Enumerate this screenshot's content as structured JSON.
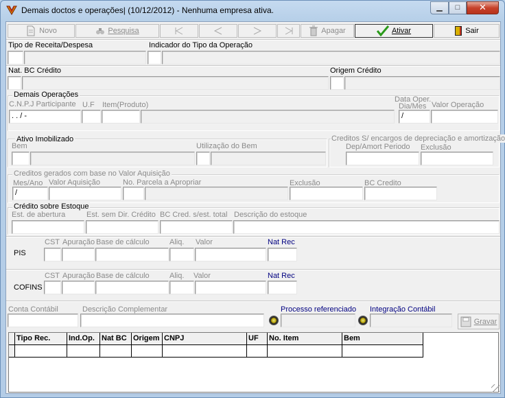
{
  "window": {
    "title": "Demais doctos e operações| (10/12/2012) - Nenhuma empresa ativa.",
    "controls": {
      "minimize": "▁",
      "maximize": "□",
      "close": "✕"
    }
  },
  "toolbar": {
    "novo": "Novo",
    "pesquisa": "Pesquisa",
    "apagar": "Apagar",
    "ativar": "Ativar",
    "sair": "Sair"
  },
  "receita": {
    "tipo_label": "Tipo de Receita/Despesa",
    "indicador_label": "Indicador do Tipo da Operação"
  },
  "credito": {
    "nat_label": "Nat. BC Crédito",
    "origem_label": "Origem Crédito"
  },
  "demais": {
    "group_title": "Demais Operações",
    "cnpj_label": "C.N.P.J Participante",
    "uf_label": "U.F",
    "item_label": "Item(Produto)",
    "data_label_1": "Data Oper.",
    "data_label_2": "Dia/Mes",
    "valor_label": "Valor Operação",
    "cnpj_value": " .  .  /  -",
    "data_value": " /"
  },
  "ativo": {
    "group_title": "Ativo Imobilizado",
    "bem_label": "Bem",
    "utilizacao_label": "Utilização do Bem"
  },
  "encargos": {
    "group_title": "Creditos S/ encargos de depreciação e amortização",
    "dep_label": "Dep/Amort Periodo",
    "exclusao_label": "Exclusão"
  },
  "aquisicao": {
    "group_title": "Creditos gerados com base no Valor Aquisição",
    "mesano_label": "Mes/Ano",
    "valor_label": "Valor Aquisição",
    "parcela_label": "No. Parcela a Apropriar",
    "exclusao_label": "Exclusão",
    "bc_label": "BC Credito",
    "mesano_value": " /"
  },
  "estoque": {
    "group_title": "Crédito sobre Estoque",
    "abertura_label": "Est. de abertura",
    "semdir_label": "Est. sem Dir. Crédito",
    "bccred_label": "BC Cred. s/est. total",
    "descricao_label": "Descrição do estoque"
  },
  "pis": {
    "title": "PIS",
    "cst_label": "CST",
    "apuracao_label": "Apuração",
    "base_label": "Base de cálculo",
    "aliq_label": "Aliq.",
    "valor_label": "Valor",
    "natrec_label": "Nat Rec"
  },
  "cofins": {
    "title": "COFINS",
    "cst_label": "CST",
    "apuracao_label": "Apuração",
    "base_label": "Base de cálculo",
    "aliq_label": "Aliq.",
    "valor_label": "Valor",
    "natrec_label": "Nat Rec"
  },
  "bottom": {
    "conta_label": "Conta Contábil",
    "descricao_label": "Descrição Complementar",
    "processo_label": "Processo referenciado",
    "integracao_label": "Integração Contábil",
    "gravar": "Gravar"
  },
  "grid": {
    "columns": [
      "Tipo Rec.",
      "Ind.Op.",
      "Nat BC",
      "Origem",
      "CNPJ",
      "UF",
      "No. Item",
      "Bem"
    ]
  },
  "colors": {
    "accent_blue": "#000080",
    "disabled_text": "#8a8a8a"
  }
}
